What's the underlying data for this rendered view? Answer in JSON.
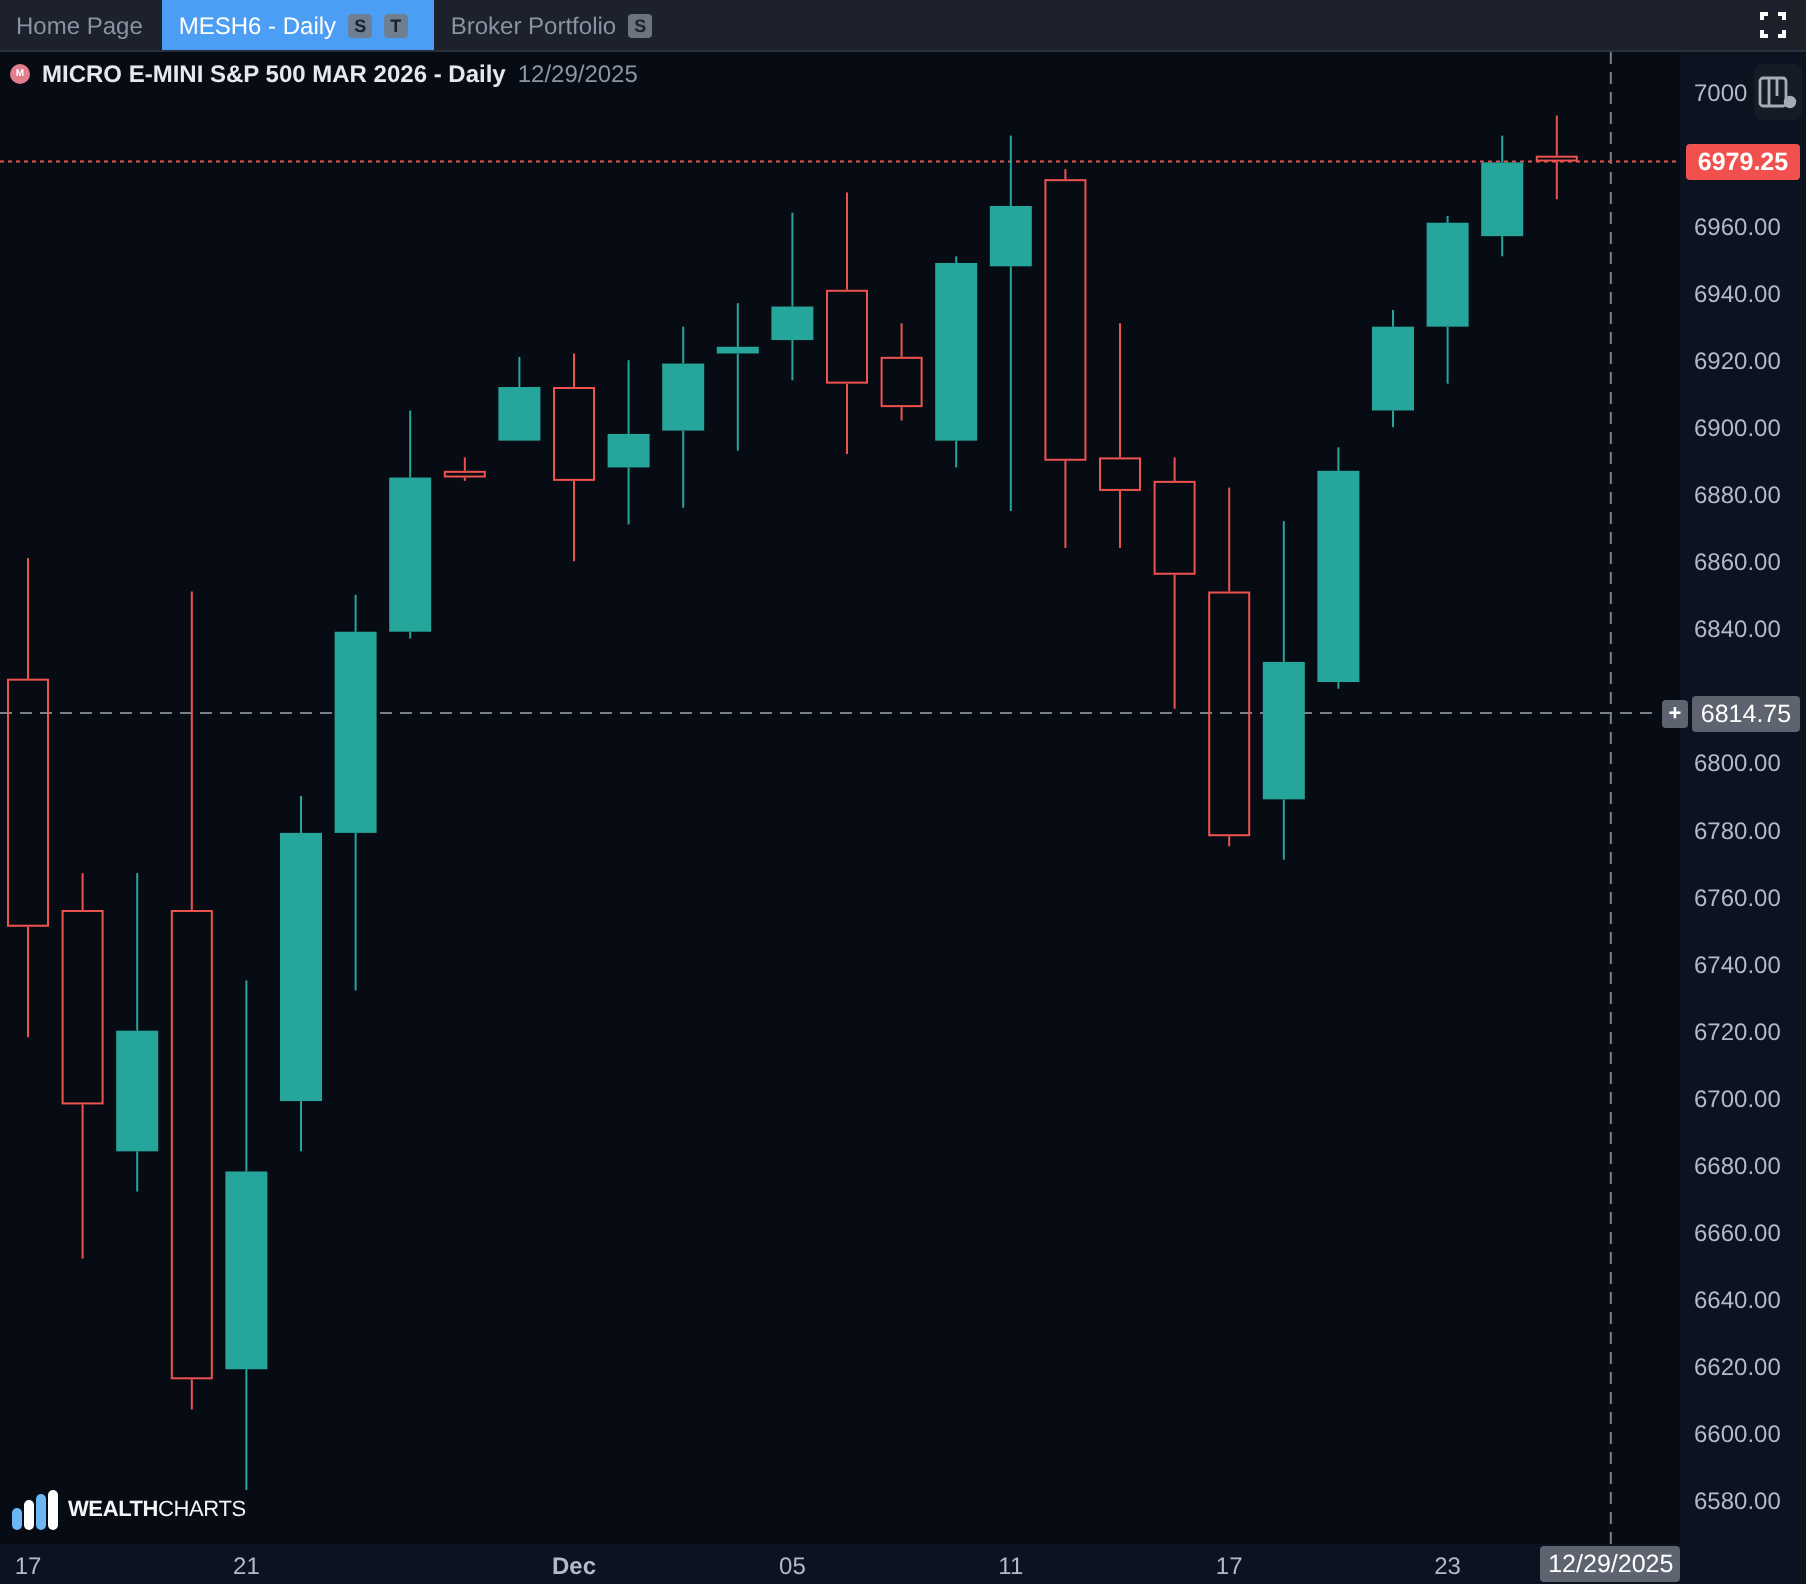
{
  "tabs": [
    {
      "label": "Home Page",
      "selected": false
    },
    {
      "label": "MESH6 - Daily",
      "selected": true,
      "badges": [
        "S",
        "T"
      ]
    },
    {
      "label": "Broker Portfolio",
      "selected": false,
      "badges": [
        "S"
      ]
    }
  ],
  "chart": {
    "symbol_badge": "M",
    "title": "MICRO E-MINI S&P 500 MAR 2026 - Daily",
    "date": "12/29/2025",
    "last_price": "6979.25",
    "crosshair_price": "6814.75",
    "crosshair_plus": "+",
    "crosshair_date": "12/29/2025",
    "brand": {
      "strong": "WEALTH",
      "light": "CHARTS"
    },
    "price_axis": [
      "7000",
      "6960.00",
      "6940.00",
      "6920.00",
      "6900.00",
      "6880.00",
      "6860.00",
      "6840.00",
      "6800.00",
      "6780.00",
      "6760.00",
      "6740.00",
      "6720.00",
      "6700.00",
      "6680.00",
      "6660.00",
      "6640.00",
      "6620.00",
      "6600.00",
      "6580.00"
    ],
    "date_axis": [
      "17",
      "21",
      "Dec",
      "05",
      "11",
      "17",
      "23"
    ]
  }
}
